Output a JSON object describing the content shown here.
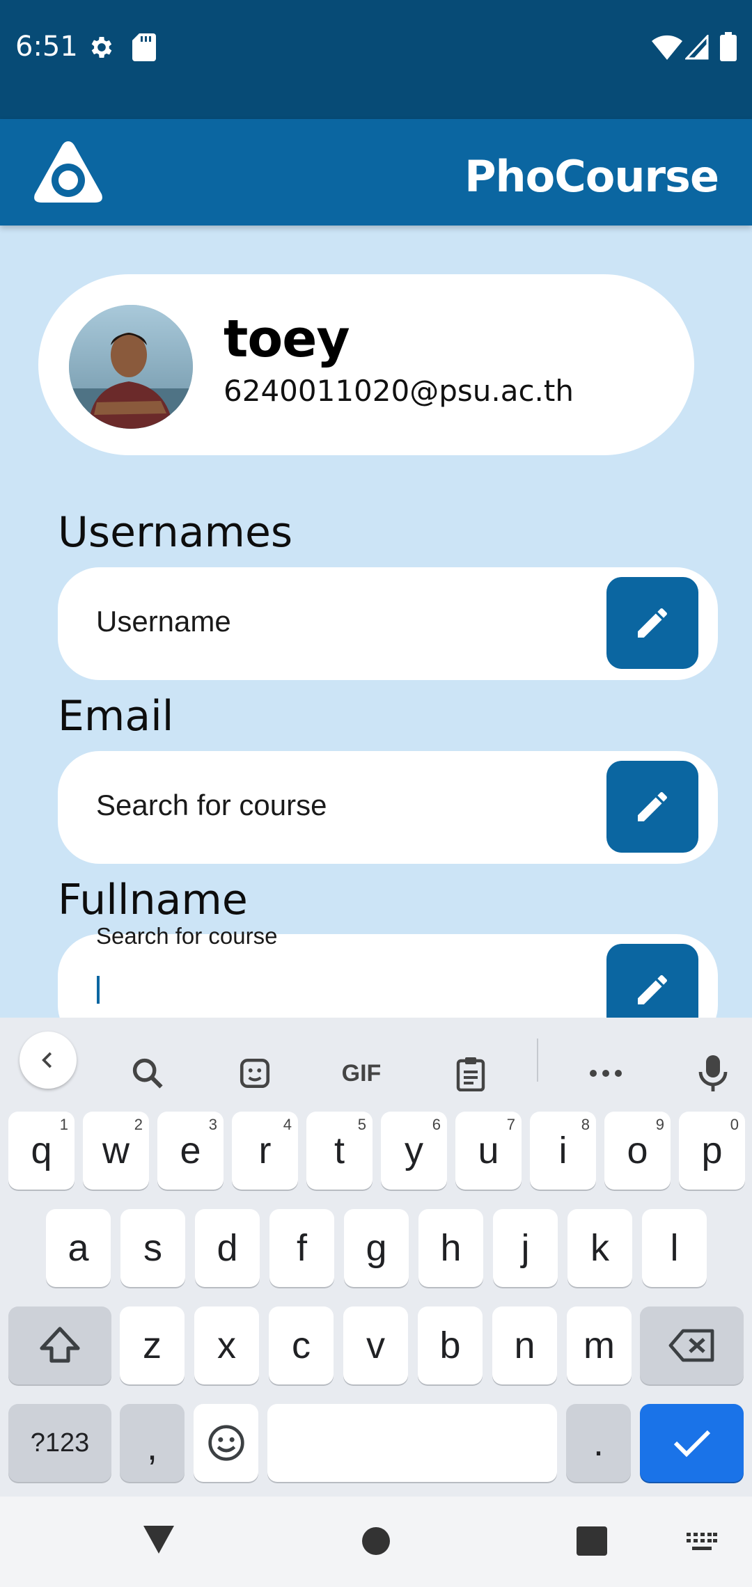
{
  "status_bar": {
    "time": "6:51"
  },
  "app_bar": {
    "title": "PhoCourse"
  },
  "profile": {
    "name": "toey",
    "email": "6240011020@psu.ac.th"
  },
  "sections": {
    "username": {
      "label": "Usernames",
      "field_text": "Username"
    },
    "email": {
      "label": "Email",
      "field_text": "Search for course"
    },
    "fullname": {
      "label": "Fullname",
      "field_floating_label": "Search for course"
    }
  },
  "keyboard": {
    "toolbar": [
      "back-icon",
      "search-icon",
      "sticker-icon",
      "GIF",
      "clipboard-icon",
      "more-icon",
      "mic-icon"
    ],
    "row1": [
      {
        "k": "q",
        "h": "1"
      },
      {
        "k": "w",
        "h": "2"
      },
      {
        "k": "e",
        "h": "3"
      },
      {
        "k": "r",
        "h": "4"
      },
      {
        "k": "t",
        "h": "5"
      },
      {
        "k": "y",
        "h": "6"
      },
      {
        "k": "u",
        "h": "7"
      },
      {
        "k": "i",
        "h": "8"
      },
      {
        "k": "o",
        "h": "9"
      },
      {
        "k": "p",
        "h": "0"
      }
    ],
    "row2": [
      "a",
      "s",
      "d",
      "f",
      "g",
      "h",
      "j",
      "k",
      "l"
    ],
    "row3": [
      "z",
      "x",
      "c",
      "v",
      "b",
      "n",
      "m"
    ],
    "symbols_label": "?123",
    "comma": ",",
    "period": "."
  },
  "colors": {
    "primary": "#0b66a1",
    "status_bar": "#074b76",
    "background": "#cce4f6",
    "enter_key": "#1a73e8"
  }
}
